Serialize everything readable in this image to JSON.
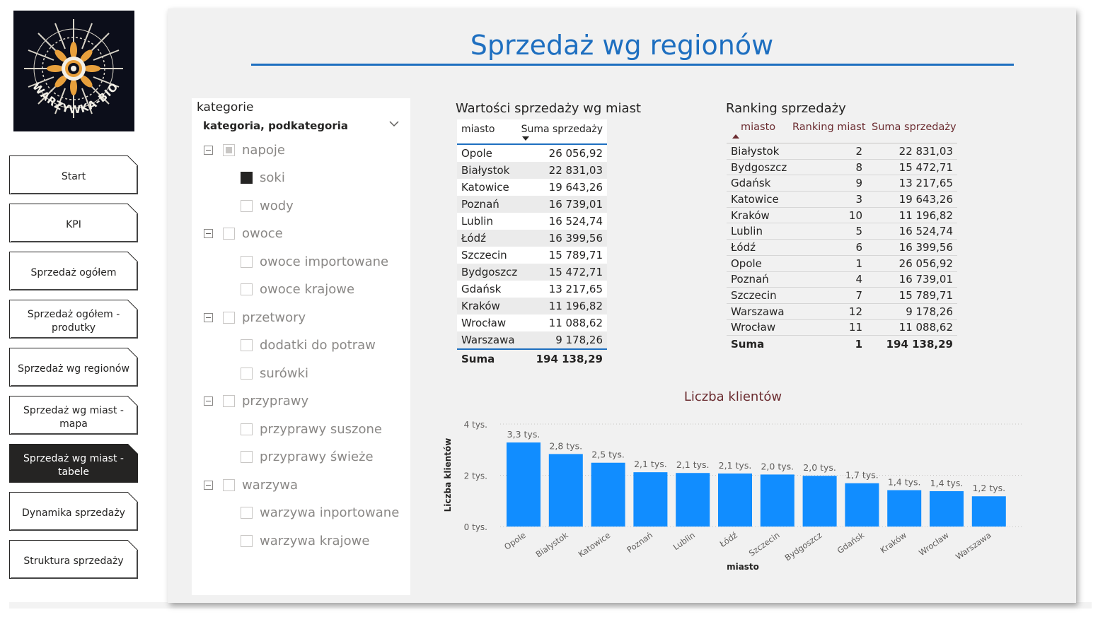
{
  "logo": {
    "text": "WARZYWKA-BIO"
  },
  "nav": {
    "items": [
      {
        "label": "Start",
        "active": false
      },
      {
        "label": "KPI",
        "active": false
      },
      {
        "label": "Sprzedaż ogółem",
        "active": false
      },
      {
        "label": "Sprzedaż ogółem - produtky",
        "active": false
      },
      {
        "label": "Sprzedaż wg regionów",
        "active": false
      },
      {
        "label": "Sprzedaż wg miast - mapa",
        "active": false
      },
      {
        "label": "Sprzedaż wg miast - tabele",
        "active": true
      },
      {
        "label": "Dynamika sprzedaży",
        "active": false
      },
      {
        "label": "Struktura sprzedaży",
        "active": false
      }
    ]
  },
  "page": {
    "title": "Sprzedaż wg regionów"
  },
  "slicer": {
    "title": "kategorie",
    "field": "kategoria, podkategoria",
    "groups": [
      {
        "label": "napoje",
        "state": "partial",
        "children": [
          {
            "label": "soki",
            "checked": true
          },
          {
            "label": "wody",
            "checked": false
          }
        ]
      },
      {
        "label": "owoce",
        "state": "none",
        "children": [
          {
            "label": "owoce importowane",
            "checked": false
          },
          {
            "label": "owoce krajowe",
            "checked": false
          }
        ]
      },
      {
        "label": "przetwory",
        "state": "none",
        "children": [
          {
            "label": "dodatki do potraw",
            "checked": false
          },
          {
            "label": "surówki",
            "checked": false
          }
        ]
      },
      {
        "label": "przyprawy",
        "state": "none",
        "children": [
          {
            "label": "przyprawy suszone",
            "checked": false
          },
          {
            "label": "przyprawy świeże",
            "checked": false
          }
        ]
      },
      {
        "label": "warzywa",
        "state": "none",
        "children": [
          {
            "label": "warzywa inportowane",
            "checked": false
          },
          {
            "label": "warzywa krajowe",
            "checked": false
          }
        ]
      }
    ]
  },
  "sales_table": {
    "title": "Wartości sprzedaży wg miast",
    "columns": [
      "miasto",
      "Suma sprzedaży"
    ],
    "rows": [
      [
        "Opole",
        "26 056,92"
      ],
      [
        "Białystok",
        "22 831,03"
      ],
      [
        "Katowice",
        "19 643,26"
      ],
      [
        "Poznań",
        "16 739,01"
      ],
      [
        "Lublin",
        "16 524,74"
      ],
      [
        "Łódź",
        "16 399,56"
      ],
      [
        "Szczecin",
        "15 789,71"
      ],
      [
        "Bydgoszcz",
        "15 472,71"
      ],
      [
        "Gdańsk",
        "13 217,65"
      ],
      [
        "Kraków",
        "11 196,82"
      ],
      [
        "Wrocław",
        "11 088,62"
      ],
      [
        "Warszawa",
        "9 178,26"
      ]
    ],
    "total": [
      "Suma",
      "194 138,29"
    ]
  },
  "ranking_table": {
    "title": "Ranking sprzedaży",
    "columns": [
      "miasto",
      "Ranking miast",
      "Suma sprzedaży"
    ],
    "rows": [
      [
        "Białystok",
        "2",
        "22 831,03"
      ],
      [
        "Bydgoszcz",
        "8",
        "15 472,71"
      ],
      [
        "Gdańsk",
        "9",
        "13 217,65"
      ],
      [
        "Katowice",
        "3",
        "19 643,26"
      ],
      [
        "Kraków",
        "10",
        "11 196,82"
      ],
      [
        "Lublin",
        "5",
        "16 524,74"
      ],
      [
        "Łódź",
        "6",
        "16 399,56"
      ],
      [
        "Opole",
        "1",
        "26 056,92"
      ],
      [
        "Poznań",
        "4",
        "16 739,01"
      ],
      [
        "Szczecin",
        "7",
        "15 789,71"
      ],
      [
        "Warszawa",
        "12",
        "9 178,26"
      ],
      [
        "Wrocław",
        "11",
        "11 088,62"
      ]
    ],
    "total": [
      "Suma",
      "1",
      "194 138,29"
    ]
  },
  "chart_data": {
    "type": "bar",
    "title": "Liczba klientów",
    "xlabel": "miasto",
    "ylabel": "Liczba klientów",
    "ylim": [
      0,
      4000
    ],
    "yticks": [
      {
        "value": 0,
        "label": "0 tys."
      },
      {
        "value": 2000,
        "label": "2 tys."
      },
      {
        "value": 4000,
        "label": "4 tys."
      }
    ],
    "grid": true,
    "color": "#118dff",
    "categories": [
      "Opole",
      "Białystok",
      "Katowice",
      "Poznań",
      "Lublin",
      "Łódź",
      "Szczecin",
      "Bydgoszcz",
      "Gdańsk",
      "Kraków",
      "Wrocław",
      "Warszawa"
    ],
    "values": [
      3280,
      2830,
      2490,
      2120,
      2090,
      2070,
      2030,
      1980,
      1690,
      1420,
      1380,
      1180
    ],
    "data_labels": [
      "3,3 tys.",
      "2,8 tys.",
      "2,5 tys.",
      "2,1 tys.",
      "2,1 tys.",
      "2,1 tys.",
      "2,0 tys.",
      "2,0 tys.",
      "1,7 tys.",
      "1,4 tys.",
      "1,4 tys.",
      "1,2 tys."
    ]
  }
}
